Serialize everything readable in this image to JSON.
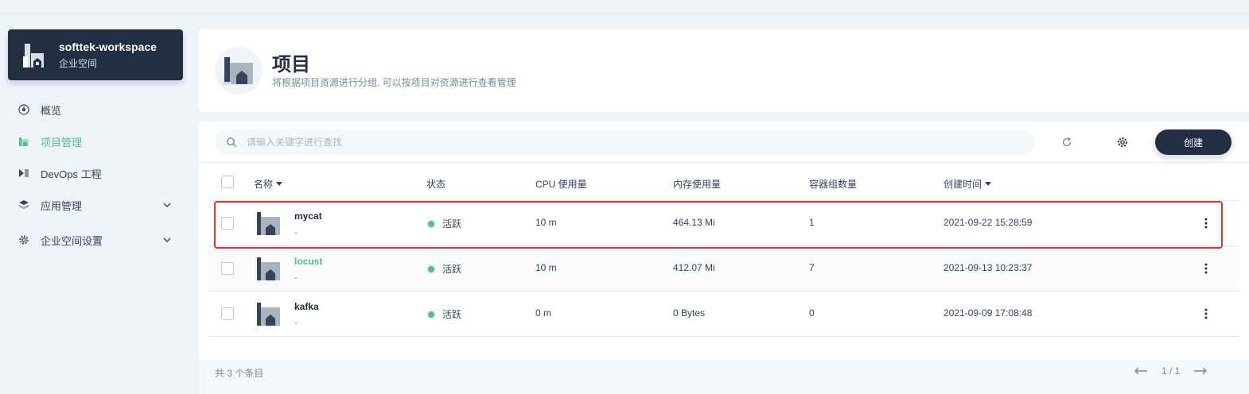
{
  "workspace": {
    "name": "softtek-workspace",
    "subtitle": "企业空间"
  },
  "sidebar": {
    "items": [
      {
        "label": "概览",
        "icon": "dashboard-icon"
      },
      {
        "label": "项目管理",
        "icon": "project-icon",
        "active": true
      },
      {
        "label": "DevOps 工程",
        "icon": "devops-icon"
      },
      {
        "label": "应用管理",
        "icon": "app-stack-icon"
      },
      {
        "label": "企业空间设置",
        "icon": "gear-icon"
      }
    ]
  },
  "header": {
    "title": "项目",
    "description": "将根据项目资源进行分组, 可以按项目对资源进行查看管理"
  },
  "toolbar": {
    "search_placeholder": "请输入关键字进行查找",
    "create_label": "创建"
  },
  "table": {
    "columns": {
      "name": "名称",
      "status": "状态",
      "cpu": "CPU 使用量",
      "memory": "内存使用量",
      "pods": "容器组数量",
      "created": "创建时间"
    },
    "rows": [
      {
        "name": "mycat",
        "desc": "-",
        "status": "活跃",
        "cpu": "10 m",
        "memory": "464.13 Mi",
        "pods": "1",
        "created": "2021-09-22 15:28:59"
      },
      {
        "name": "locust",
        "desc": "-",
        "status": "活跃",
        "cpu": "10 m",
        "memory": "412.07 Mi",
        "pods": "7",
        "created": "2021-09-13 10:23:37"
      },
      {
        "name": "kafka",
        "desc": "-",
        "status": "活跃",
        "cpu": "0 m",
        "memory": "0 Bytes",
        "pods": "0",
        "created": "2021-09-09 17:08:48"
      }
    ]
  },
  "footer": {
    "total": "共 3 个条目",
    "page": "1 / 1"
  },
  "colors": {
    "accent": "#55bc8a",
    "dark": "#242e42",
    "highlight": "#e2352a"
  }
}
